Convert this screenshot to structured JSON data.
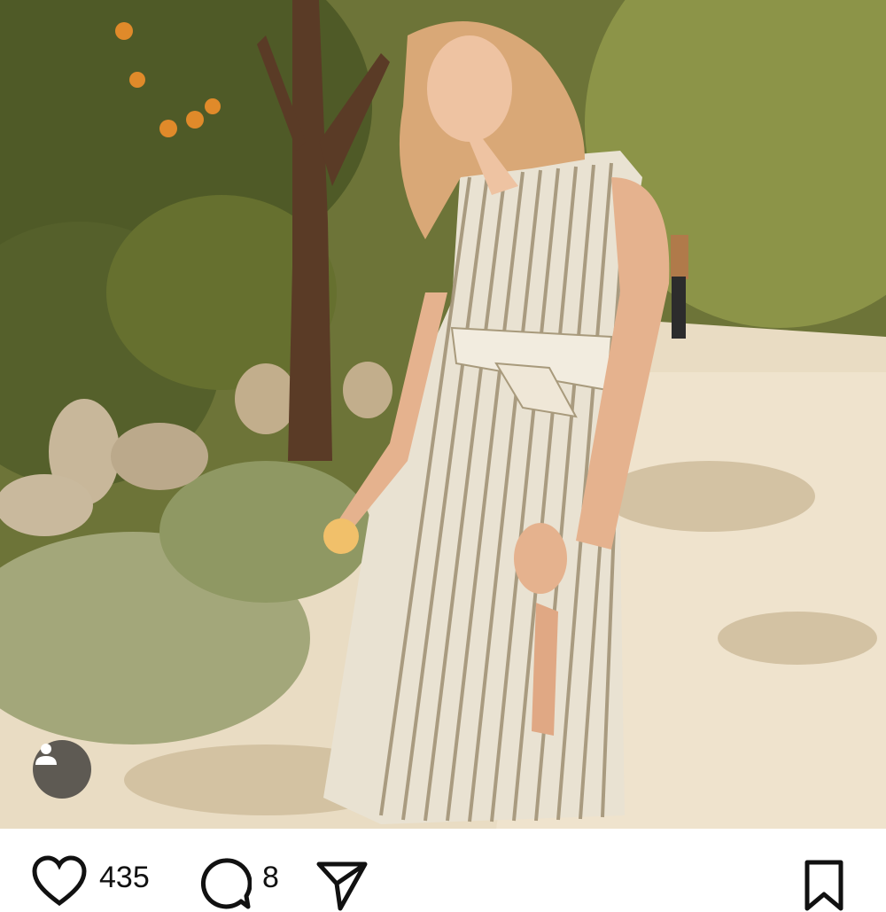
{
  "photo": {
    "description_icon": "striped-dress-photo"
  },
  "user_tag": {
    "icon": "person-icon"
  },
  "actions": {
    "likes_count": "435",
    "comments_count": "8",
    "like_icon": "heart-icon",
    "comment_icon": "comment-bubble-icon",
    "share_icon": "send-paper-plane-icon",
    "save_icon": "bookmark-icon"
  },
  "colors": {
    "icon_stroke": "#111111",
    "tag_bg": "#3a3a3a"
  }
}
